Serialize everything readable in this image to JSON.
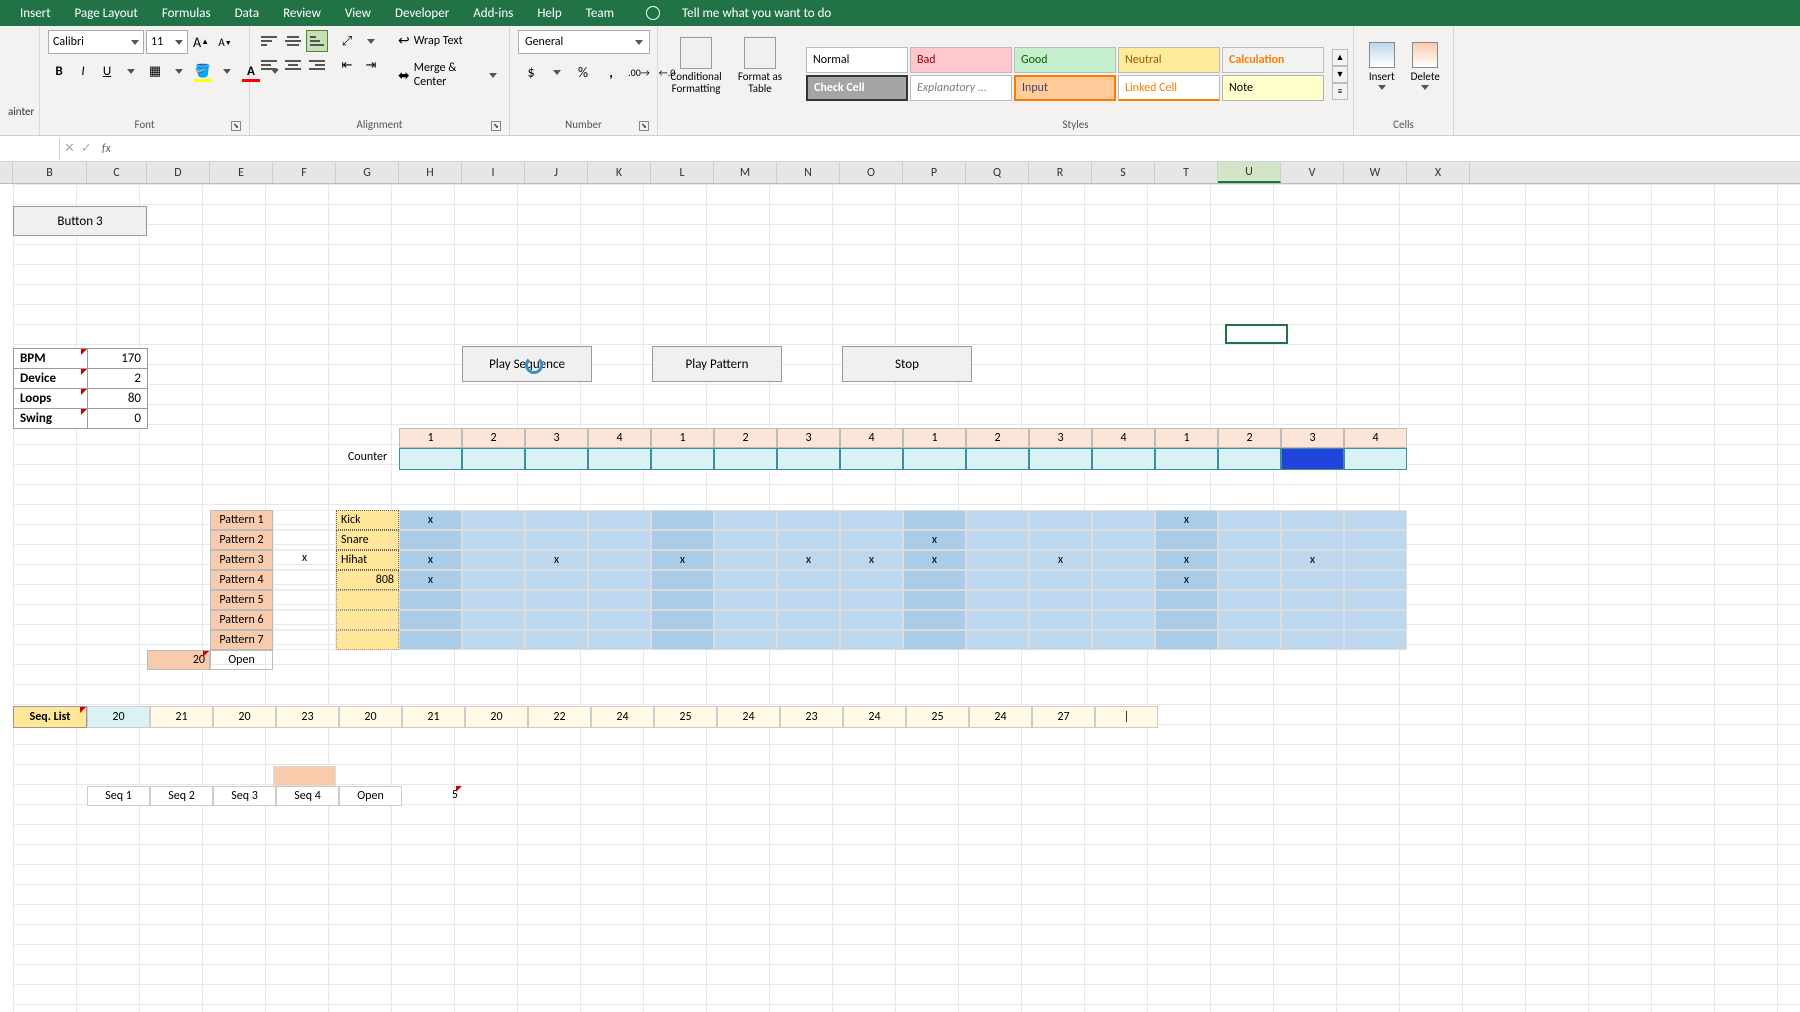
{
  "menu": [
    "Insert",
    "Page Layout",
    "Formulas",
    "Data",
    "Review",
    "View",
    "Developer",
    "Add-ins",
    "Help",
    "Team"
  ],
  "tell_me": "Tell me what you want to do",
  "ribbon": {
    "painter": "ainter",
    "font_name": "Calibri",
    "font_size": "11",
    "group_font": "Font",
    "group_align": "Alignment",
    "group_number": "Number",
    "group_styles": "Styles",
    "group_cells": "Cells",
    "wrap": "Wrap Text",
    "merge": "Merge & Center",
    "number_format": "General",
    "cond_fmt": "Conditional Formatting",
    "fmt_table": "Format as Table",
    "insert": "Insert",
    "delete": "Delete",
    "styles": {
      "normal": "Normal",
      "bad": "Bad",
      "good": "Good",
      "neutral": "Neutral",
      "calculation": "Calculation",
      "check": "Check Cell",
      "explan": "Explanatory ...",
      "input": "Input",
      "linked": "Linked Cell",
      "note": "Note"
    }
  },
  "columns": [
    "B",
    "C",
    "D",
    "E",
    "F",
    "G",
    "H",
    "I",
    "J",
    "K",
    "L",
    "M",
    "N",
    "O",
    "P",
    "Q",
    "R",
    "S",
    "T",
    "U",
    "V",
    "W",
    "X"
  ],
  "selected_col": "U",
  "button3": "Button 3",
  "params": {
    "bpm_label": "BPM",
    "bpm": "170",
    "device_label": "Device",
    "device": "2",
    "loops_label": "Loops",
    "loops": "80",
    "swing_label": "Swing",
    "swing": "0"
  },
  "buttons": {
    "play_seq": "Play Sequence",
    "play_pat": "Play Pattern",
    "stop": "Stop"
  },
  "counter_label": "Counter",
  "step_numbers": [
    "1",
    "2",
    "3",
    "4",
    "1",
    "2",
    "3",
    "4",
    "1",
    "2",
    "3",
    "4",
    "1",
    "2",
    "3",
    "4"
  ],
  "counter_active_index": 14,
  "patterns": {
    "labels": [
      "Pattern 1",
      "Pattern 2",
      "Pattern 3",
      "Pattern 4",
      "Pattern 5",
      "Pattern 6",
      "Pattern 7"
    ],
    "selected_x_col": "F",
    "instruments": [
      "Kick",
      "Snare",
      "Hihat",
      "808",
      "",
      "",
      ""
    ],
    "grid": [
      [
        "x",
        "",
        "",
        "",
        "",
        "",
        "",
        "",
        "",
        "",
        "",
        "",
        "x",
        "",
        "",
        ""
      ],
      [
        "",
        "",
        "",
        "",
        "",
        "",
        "",
        "",
        "x",
        "",
        "",
        "",
        "",
        "",
        "",
        ""
      ],
      [
        "x",
        "",
        "x",
        "",
        "x",
        "",
        "x",
        "x",
        "x",
        "",
        "x",
        "",
        "x",
        "",
        "x",
        ""
      ],
      [
        "x",
        "",
        "",
        "",
        "",
        "",
        "",
        "",
        "",
        "",
        "",
        "",
        "x",
        "",
        "",
        ""
      ],
      [
        "",
        "",
        "",
        "",
        "",
        "",
        "",
        "",
        "",
        "",
        "",
        "",
        "",
        "",
        "",
        ""
      ],
      [
        "",
        "",
        "",
        "",
        "",
        "",
        "",
        "",
        "",
        "",
        "",
        "",
        "",
        "",
        "",
        ""
      ],
      [
        "",
        "",
        "",
        "",
        "",
        "",
        "",
        "",
        "",
        "",
        "",
        "",
        "",
        "",
        "",
        ""
      ]
    ],
    "open_row": {
      "num": "20",
      "label": "Open"
    }
  },
  "seq_list": {
    "header": "Seq. List",
    "values": [
      "20",
      "21",
      "20",
      "23",
      "20",
      "21",
      "20",
      "22",
      "24",
      "25",
      "24",
      "23",
      "24",
      "25",
      "24",
      "27",
      "|"
    ]
  },
  "bottom": {
    "labels": [
      "Seq 1",
      "Seq 2",
      "Seq 3",
      "Seq 4",
      "Open"
    ],
    "extra": "5"
  }
}
